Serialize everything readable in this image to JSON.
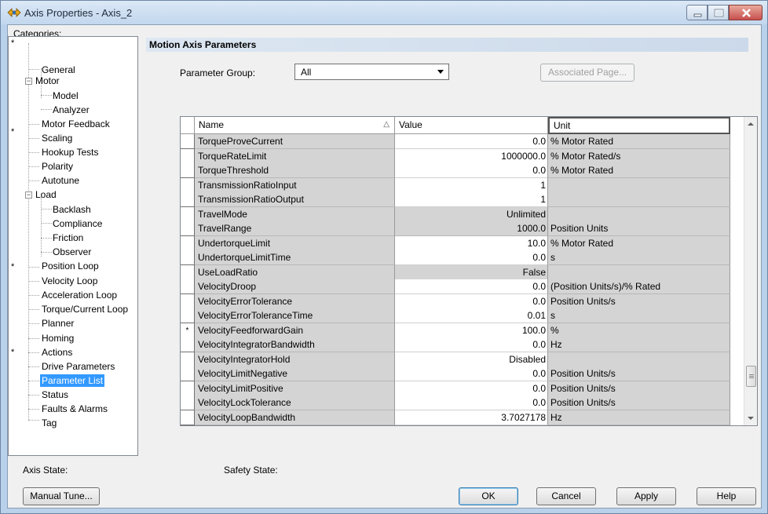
{
  "window": {
    "title": "Axis Properties - Axis_2",
    "icon": "axis-properties-icon"
  },
  "categories_label": "Categories:",
  "tree": [
    {
      "label": "General",
      "starred": true
    },
    {
      "label": "Motor",
      "expanded": true
    },
    {
      "label": "Model"
    },
    {
      "label": "Analyzer"
    },
    {
      "label": "Motor Feedback"
    },
    {
      "label": "Scaling",
      "starred": true
    },
    {
      "label": "Hookup Tests"
    },
    {
      "label": "Polarity"
    },
    {
      "label": "Autotune"
    },
    {
      "label": "Load",
      "expanded": true
    },
    {
      "label": "Backlash"
    },
    {
      "label": "Compliance"
    },
    {
      "label": "Friction"
    },
    {
      "label": "Observer"
    },
    {
      "label": "Position Loop",
      "starred": true
    },
    {
      "label": "Velocity Loop"
    },
    {
      "label": "Acceleration Loop"
    },
    {
      "label": "Torque/Current Loop"
    },
    {
      "label": "Planner"
    },
    {
      "label": "Homing"
    },
    {
      "label": "Actions",
      "starred": true
    },
    {
      "label": "Drive Parameters"
    },
    {
      "label": "Parameter List",
      "selected": true
    },
    {
      "label": "Status"
    },
    {
      "label": "Faults & Alarms"
    },
    {
      "label": "Tag"
    }
  ],
  "section_title": "Motion Axis Parameters",
  "parameter_group": {
    "label": "Parameter Group:",
    "value": "All"
  },
  "associated_page_label": "Associated Page...",
  "grid": {
    "columns": [
      "Name",
      "Value",
      "Unit"
    ],
    "sort_indicator": "△",
    "rows": [
      {
        "name": "TorqueProveCurrent",
        "value": "0.0",
        "unit": "% Motor Rated",
        "editable": true
      },
      {
        "name": "TorqueRateLimit",
        "value": "1000000.0",
        "unit": "% Motor Rated/s",
        "editable": true
      },
      {
        "name": "TorqueThreshold",
        "value": "0.0",
        "unit": "% Motor Rated",
        "editable": true
      },
      {
        "name": "TransmissionRatioInput",
        "value": "1",
        "unit": "",
        "editable": true
      },
      {
        "name": "TransmissionRatioOutput",
        "value": "1",
        "unit": "",
        "editable": true
      },
      {
        "name": "TravelMode",
        "value": "Unlimited",
        "unit": "",
        "editable": false
      },
      {
        "name": "TravelRange",
        "value": "1000.0",
        "unit": "Position Units",
        "editable": false
      },
      {
        "name": "UndertorqueLimit",
        "value": "10.0",
        "unit": "% Motor Rated",
        "editable": true
      },
      {
        "name": "UndertorqueLimitTime",
        "value": "0.0",
        "unit": "s",
        "editable": true
      },
      {
        "name": "UseLoadRatio",
        "value": "False",
        "unit": "",
        "editable": false
      },
      {
        "name": "VelocityDroop",
        "value": "0.0",
        "unit": "(Position Units/s)/% Rated",
        "editable": true
      },
      {
        "name": "VelocityErrorTolerance",
        "value": "0.0",
        "unit": "Position Units/s",
        "editable": true
      },
      {
        "name": "VelocityErrorToleranceTime",
        "value": "0.01",
        "unit": "s",
        "editable": true
      },
      {
        "name": "VelocityFeedforwardGain",
        "value": "100.0",
        "unit": "%",
        "editable": true,
        "marker": "*"
      },
      {
        "name": "VelocityIntegratorBandwidth",
        "value": "0.0",
        "unit": "Hz",
        "editable": true
      },
      {
        "name": "VelocityIntegratorHold",
        "value": "Disabled",
        "unit": "",
        "editable": true
      },
      {
        "name": "VelocityLimitNegative",
        "value": "0.0",
        "unit": "Position Units/s",
        "editable": true
      },
      {
        "name": "VelocityLimitPositive",
        "value": "0.0",
        "unit": "Position Units/s",
        "editable": true
      },
      {
        "name": "VelocityLockTolerance",
        "value": "0.0",
        "unit": "Position Units/s",
        "editable": true
      },
      {
        "name": "VelocityLoopBandwidth",
        "value": "3.7027178",
        "unit": "Hz",
        "editable": true
      }
    ]
  },
  "axis_state_label": "Axis State:",
  "safety_state_label": "Safety State:",
  "buttons": {
    "manual_tune": "Manual Tune...",
    "ok": "OK",
    "cancel": "Cancel",
    "apply": "Apply",
    "help": "Help"
  }
}
